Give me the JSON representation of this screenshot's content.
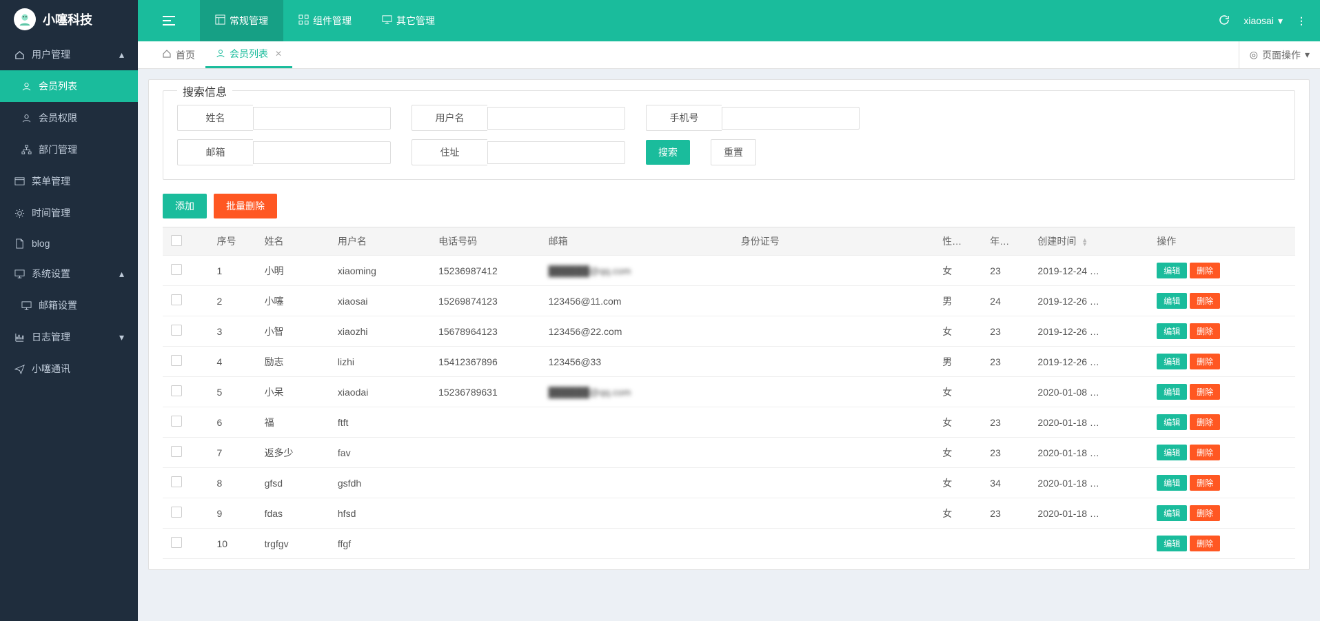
{
  "brand": "小噻科技",
  "topnav": [
    {
      "label": "常规管理",
      "icon": "layout"
    },
    {
      "label": "组件管理",
      "icon": "grid"
    },
    {
      "label": "其它管理",
      "icon": "monitor"
    }
  ],
  "user": "xiaosai",
  "sidebar": {
    "groups": [
      {
        "label": "用户管理",
        "icon": "home",
        "expanded": true,
        "items": [
          {
            "label": "会员列表",
            "icon": "user",
            "active": true
          },
          {
            "label": "会员权限",
            "icon": "user"
          },
          {
            "label": "部门管理",
            "icon": "sitemap"
          }
        ]
      },
      {
        "label": "菜单管理",
        "icon": "window"
      },
      {
        "label": "时间管理",
        "icon": "gears"
      },
      {
        "label": "blog",
        "icon": "file"
      },
      {
        "label": "系统设置",
        "icon": "monitor",
        "expanded": true,
        "items": [
          {
            "label": "邮箱设置",
            "icon": "monitor"
          }
        ]
      },
      {
        "label": "日志管理",
        "icon": "chart",
        "caret": true
      },
      {
        "label": "小噻通讯",
        "icon": "send"
      }
    ]
  },
  "tabs": {
    "home": "首页",
    "active": "会员列表",
    "pageops": "页面操作"
  },
  "search": {
    "title": "搜索信息",
    "fields": {
      "name": "姓名",
      "username": "用户名",
      "phone": "手机号",
      "email": "邮箱",
      "address": "住址"
    },
    "submit": "搜索",
    "reset": "重置"
  },
  "toolbar": {
    "add": "添加",
    "batchDelete": "批量删除"
  },
  "table": {
    "headers": {
      "idx": "序号",
      "name": "姓名",
      "username": "用户名",
      "phone": "电话号码",
      "email": "邮箱",
      "idcard": "身份证号",
      "gender": "性…",
      "age": "年…",
      "created": "创建时间",
      "op": "操作"
    },
    "ops": {
      "edit": "编辑",
      "delete": "删除"
    },
    "rows": [
      {
        "idx": 1,
        "name": "小明",
        "username": "xiaoming",
        "phone": "15236987412",
        "email": "██████@qq.com",
        "emailBlur": true,
        "idcard": "",
        "gender": "女",
        "age": "23",
        "created": "2019-12-24 …"
      },
      {
        "idx": 2,
        "name": "小噻",
        "username": "xiaosai",
        "phone": "15269874123",
        "email": "123456@11.com",
        "idcard": "",
        "gender": "男",
        "age": "24",
        "created": "2019-12-26 …"
      },
      {
        "idx": 3,
        "name": "小智",
        "username": "xiaozhi",
        "phone": "15678964123",
        "email": "123456@22.com",
        "idcard": "",
        "gender": "女",
        "age": "23",
        "created": "2019-12-26 …"
      },
      {
        "idx": 4,
        "name": "励志",
        "username": "lizhi",
        "phone": "15412367896",
        "email": "123456@33",
        "idcard": "",
        "gender": "男",
        "age": "23",
        "created": "2019-12-26 …"
      },
      {
        "idx": 5,
        "name": "小呆",
        "username": "xiaodai",
        "phone": "15236789631",
        "email": "██████@qq.com",
        "emailBlur": true,
        "idcard": "",
        "gender": "女",
        "age": "",
        "created": "2020-01-08 …"
      },
      {
        "idx": 6,
        "name": "福",
        "username": "ftft",
        "phone": "",
        "email": "",
        "idcard": "",
        "gender": "女",
        "age": "23",
        "created": "2020-01-18 …"
      },
      {
        "idx": 7,
        "name": "返多少",
        "username": "fav",
        "phone": "",
        "email": "",
        "idcard": "",
        "gender": "女",
        "age": "23",
        "created": "2020-01-18 …"
      },
      {
        "idx": 8,
        "name": "gfsd",
        "username": "gsfdh",
        "phone": "",
        "email": "",
        "idcard": "",
        "gender": "女",
        "age": "34",
        "created": "2020-01-18 …"
      },
      {
        "idx": 9,
        "name": "fdas",
        "username": "hfsd",
        "phone": "",
        "email": "",
        "idcard": "",
        "gender": "女",
        "age": "23",
        "created": "2020-01-18 …"
      },
      {
        "idx": 10,
        "name": "trgfgv",
        "username": "ffgf",
        "phone": "",
        "email": "",
        "idcard": "",
        "gender": "",
        "age": "",
        "created": ""
      }
    ]
  }
}
